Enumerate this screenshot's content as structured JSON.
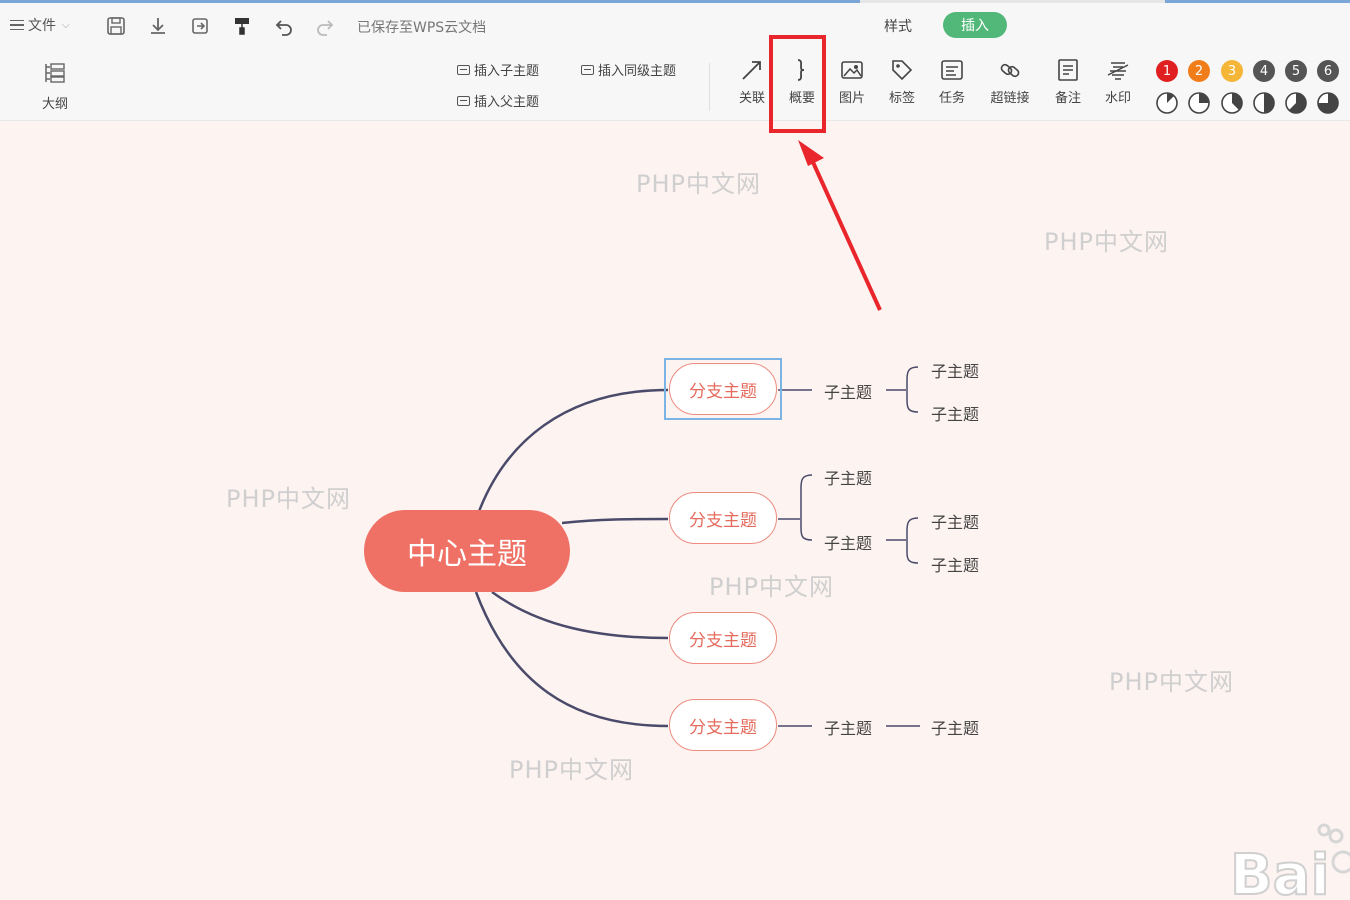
{
  "toolbar": {
    "file_menu": "文件",
    "saved_status": "已保存至WPS云文档",
    "tab_style": "样式",
    "tab_insert": "插入",
    "outline": "大纲",
    "insert_child": "插入子主题",
    "insert_sibling": "插入同级主题",
    "insert_parent": "插入父主题",
    "tools": [
      {
        "label": "关联",
        "icon": "relation-arrow-icon"
      },
      {
        "label": "概要",
        "icon": "summary-brace-icon"
      },
      {
        "label": "图片",
        "icon": "image-icon"
      },
      {
        "label": "标签",
        "icon": "tag-icon"
      },
      {
        "label": "任务",
        "icon": "task-icon"
      },
      {
        "label": "超链接",
        "icon": "link-icon"
      },
      {
        "label": "备注",
        "icon": "note-icon"
      },
      {
        "label": "水印",
        "icon": "watermark-icon"
      }
    ],
    "priorities": [
      {
        "label": "1",
        "color": "#e02020"
      },
      {
        "label": "2",
        "color": "#f07d1a"
      },
      {
        "label": "3",
        "color": "#f5b537"
      },
      {
        "label": "4",
        "color": "#555555"
      },
      {
        "label": "5",
        "color": "#555555"
      },
      {
        "label": "6",
        "color": "#555555"
      }
    ],
    "progress_levels": [
      0.125,
      0.25,
      0.375,
      0.5,
      0.625,
      0.75
    ]
  },
  "mindmap": {
    "center": "中心主题",
    "branch_label": "分支主题",
    "sub_label": "子主题"
  },
  "watermark_text": "PHP中文网",
  "colors": {
    "accent_green": "#52b879",
    "center_fill": "#ef7165",
    "branch_border": "#ec8b80",
    "highlight_red": "#e8262c",
    "connector": "#4a4a6a"
  }
}
